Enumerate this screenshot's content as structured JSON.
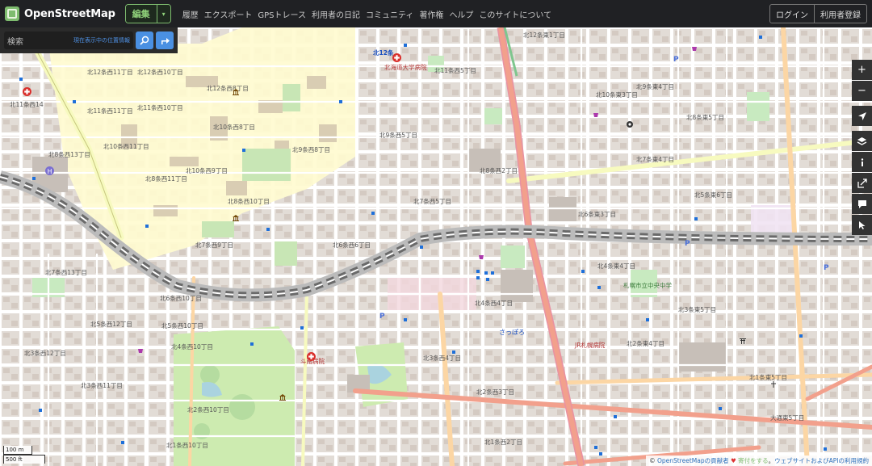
{
  "header": {
    "logo_text": "OpenStreetMap",
    "edit_label": "編集",
    "edit_caret": "▾",
    "nav": [
      "履歴",
      "エクスポート",
      "GPSトレース",
      "利用者の日記",
      "コミュニティ",
      "著作権",
      "ヘルプ",
      "このサイトについて"
    ],
    "login_label": "ログイン",
    "signup_label": "利用者登録"
  },
  "search": {
    "placeholder": "検索",
    "where_label": "現在表示中の位置情報"
  },
  "controls": {
    "zoom_in": "+",
    "zoom_out": "−"
  },
  "scale": {
    "metric": "100 m",
    "imperial": "500 ft"
  },
  "attribution": {
    "prefix": "© ",
    "contributors_link": "OpenStreetMapの貢献者",
    "heart": "♥",
    "donate_link": "寄付をする",
    "suffix": "。",
    "terms_link": "ウェブサイトおよびAPIの利用規約"
  },
  "map_labels": [
    "北12条西11丁目",
    "北12条西10丁目",
    "北12条西8丁目",
    "北12条",
    "北11条西14",
    "北11条西11丁目",
    "北11条西10丁目",
    "北10条西11丁目",
    "北10条西9丁目",
    "北10条西8丁目",
    "北9条西8丁目",
    "北8条西13丁目",
    "北8条西11丁目",
    "北8条西10丁目",
    "北7条西13丁目",
    "北7条西9丁目",
    "北6条西10丁目",
    "北5条西12丁目",
    "北5条西10丁目",
    "北4条西10丁目",
    "北3条西12丁目",
    "北3条西11丁目",
    "北2条西10丁目",
    "北1条西10丁目",
    "北12条東1丁目",
    "北10条東3丁目",
    "北9条東4丁目",
    "北8条東5丁目",
    "北7条東4丁目",
    "北6条東3丁目",
    "北5条東6丁目",
    "北4条東4丁目",
    "北3条東5丁目",
    "北2条東4丁目",
    "北1条東5丁目",
    "大通東5丁目",
    "北4条西4丁目",
    "北3条西4丁目",
    "北2条西3丁目",
    "北1条西2丁目",
    "北7条西5丁目",
    "北9条西5丁目",
    "北11条西5丁目",
    "北8条西2丁目",
    "北6条西6丁目"
  ],
  "place_labels": {
    "hospital_north": "北海道大学病院",
    "hospital_south": "JR札幌病院",
    "hospital_clinic": "斗南病院",
    "station": "さっぽろ",
    "school": "札幌市立中央中学"
  }
}
